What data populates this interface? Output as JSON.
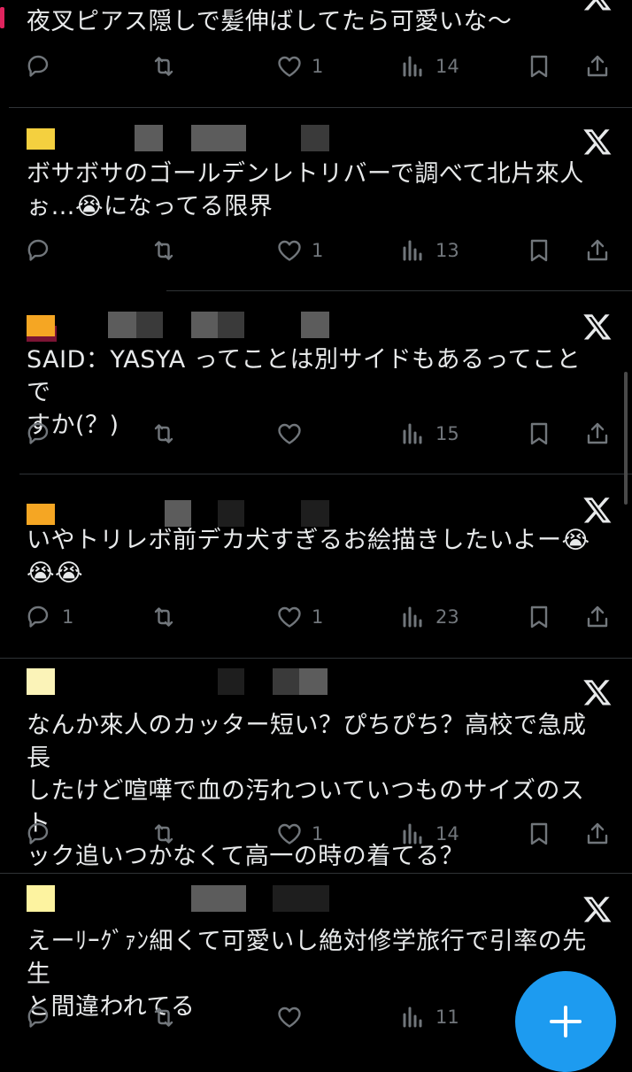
{
  "posts": [
    {
      "text": "夜叉ピアス隠しで髪伸ばしてたら可愛いな〜",
      "reply": "",
      "retweet": "",
      "like": "1",
      "views": "14"
    },
    {
      "text": "ボサボサのゴールデンレトリバーで調べて北片來人\nぉ…😭になってる限界",
      "reply": "",
      "retweet": "",
      "like": "1",
      "views": "13"
    },
    {
      "text": "SAID：YASYA ってことは別サイドもあるってことで\nすか(？)",
      "reply": "",
      "retweet": "",
      "like": "",
      "views": "15"
    },
    {
      "text": "いやトリレボ前デカ犬すぎるお絵描きしたいよー😭\n😭😭",
      "reply": "1",
      "retweet": "",
      "like": "1",
      "views": "23"
    },
    {
      "text": "なんか來人のカッター短い？ぴちぴち？高校で急成長\nしたけど喧嘩で血の汚れついていつものサイズのスト\nック追いつかなくて高一の時の着てる？",
      "reply": "",
      "retweet": "",
      "like": "1",
      "views": "14"
    },
    {
      "text": "えーﾘｰｸﾞｧﾝ細くて可愛いし絶対修学旅行で引率の先生\nと間違われてる",
      "reply": "",
      "retweet": "",
      "like": "",
      "views": "11"
    }
  ],
  "colors": {
    "accent": "#1d9bf0",
    "icon": "#71767b",
    "text": "#e7e9ea",
    "background": "#000000",
    "separator": "#2f3336"
  },
  "icons": {
    "reply": "reply-bubble-icon",
    "retweet": "retweet-icon",
    "like": "heart-icon",
    "views": "views-bar-chart-icon",
    "bookmark": "bookmark-icon",
    "share": "share-icon",
    "source": "x-logo-icon",
    "compose": "plus-icon"
  }
}
